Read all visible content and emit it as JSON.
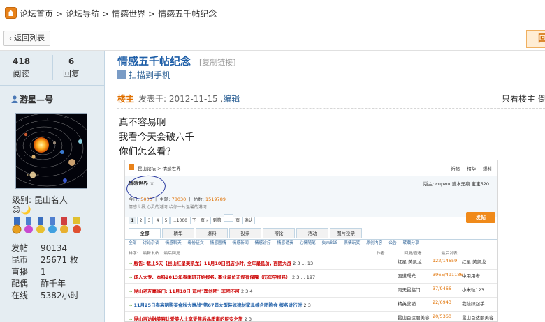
{
  "breadcrumb": {
    "items": [
      "论坛首页",
      "论坛导航",
      "情感世界",
      "情感五千帖纪念"
    ],
    "separator": ">"
  },
  "toolbar": {
    "back_label": "返回列表",
    "right_button_label": "回"
  },
  "stats": {
    "views_value": "418",
    "views_label": "阅读",
    "replies_value": "6",
    "replies_label": "回复"
  },
  "thread": {
    "title": "情感五千帖纪念",
    "copy_link": "[复制链接]",
    "mobile_label": "扫描到手机"
  },
  "author": {
    "name": "游星—号",
    "level": "级别: 昆山名人",
    "emoji": "😊🌙",
    "info": [
      {
        "key": "发帖",
        "value": "90134"
      },
      {
        "key": "昆币",
        "value": "25671 枚"
      },
      {
        "key": "直播",
        "value": "1"
      },
      {
        "key": "配偶",
        "value": "酢千年"
      },
      {
        "key": "在线",
        "value": "5382小时"
      }
    ]
  },
  "post": {
    "owner_label": "楼主",
    "date_text": "发表于: 2012-11-15 ,",
    "edit_label": "编辑",
    "view_owner": "只看楼主 倒",
    "lines": [
      "真不容易啊",
      "我看今天会破六千",
      "你们怎么看？"
    ]
  },
  "embedded": {
    "crumb": "昆山论坛 > 情感世界",
    "top_links": "新帖 精华 爆料",
    "forum_name": "情感世界 ☆",
    "moderators": "版主: cupwu 落水无痕 宝宝520",
    "today_label": "今日:",
    "today_value": "5000",
    "topics_label": "主题:",
    "topics_value": "78030",
    "posts_label": "帖数:",
    "posts_value": "1519789",
    "desc": "情感世界,心灵的港湾,给你一片温馨的港湾",
    "pages": [
      "1",
      "2",
      "3",
      "4",
      "5",
      "...1000",
      "下一页 »",
      "到第",
      "页",
      "确认"
    ],
    "post_button": "发帖",
    "tabs": [
      "全部",
      "精华",
      "爆料",
      "投票",
      "辩论",
      "活动",
      "图片投票"
    ],
    "categories": "全部 讨论杂谈 情感聊天 缘份征文 情感围情 情感新闻 情感诊疗 情感谴责 心情随笔 失未818 表情玩笑 原创内容 公告 转载分享",
    "sort": "排序: 最新发帖 最后回复",
    "cols": "作者 回复/查看 最后发表",
    "rows": [
      {
        "title": "版告: 截止5天【昆山红星美凯龙】11月18日团店小时, 全年最低价, 百团大战",
        "pages": "2 3 ... 13",
        "author": "红星.美凯龙",
        "nums": "122/14659",
        "last": "红星.美凯龙",
        "color": "red"
      },
      {
        "title": "成人大专、本科2013年春季班开始报名, 事业单位正规有保障（历年学报名）",
        "pages": "2 3 ... 197",
        "author": "面道曙光",
        "nums": "3965/491186",
        "last": "中用用者",
        "color": "red"
      },
      {
        "title": "昆山老友嘉临门: 11月18日 逛村\"理创团\" 非团不可",
        "pages": "2 3 4",
        "author": "南无昆临门",
        "nums": "37/9466",
        "last": "小米粒123",
        "color": "red"
      },
      {
        "title": "11月25日春高明购买金秋大惠战\"第67届大型装修建材家具综合团购会 报名进行时",
        "pages": "2 3",
        "author": "精英营销",
        "nums": "22/6943",
        "last": "我结绿起手",
        "color": "blue"
      },
      {
        "title": "昆山百达融美容让爱美人士享受焦后品质南的服安之旅",
        "pages": "2 3",
        "author": "昆山百达丽美容",
        "nums": "20/5360",
        "last": "昆山百达丽美容",
        "color": "red"
      }
    ]
  },
  "colors": {
    "title_blue": "#1f5fa8",
    "owner_orange": "#e07000",
    "sidebar_bg": "#e5edf2",
    "border_blue": "#c2d5e3"
  }
}
